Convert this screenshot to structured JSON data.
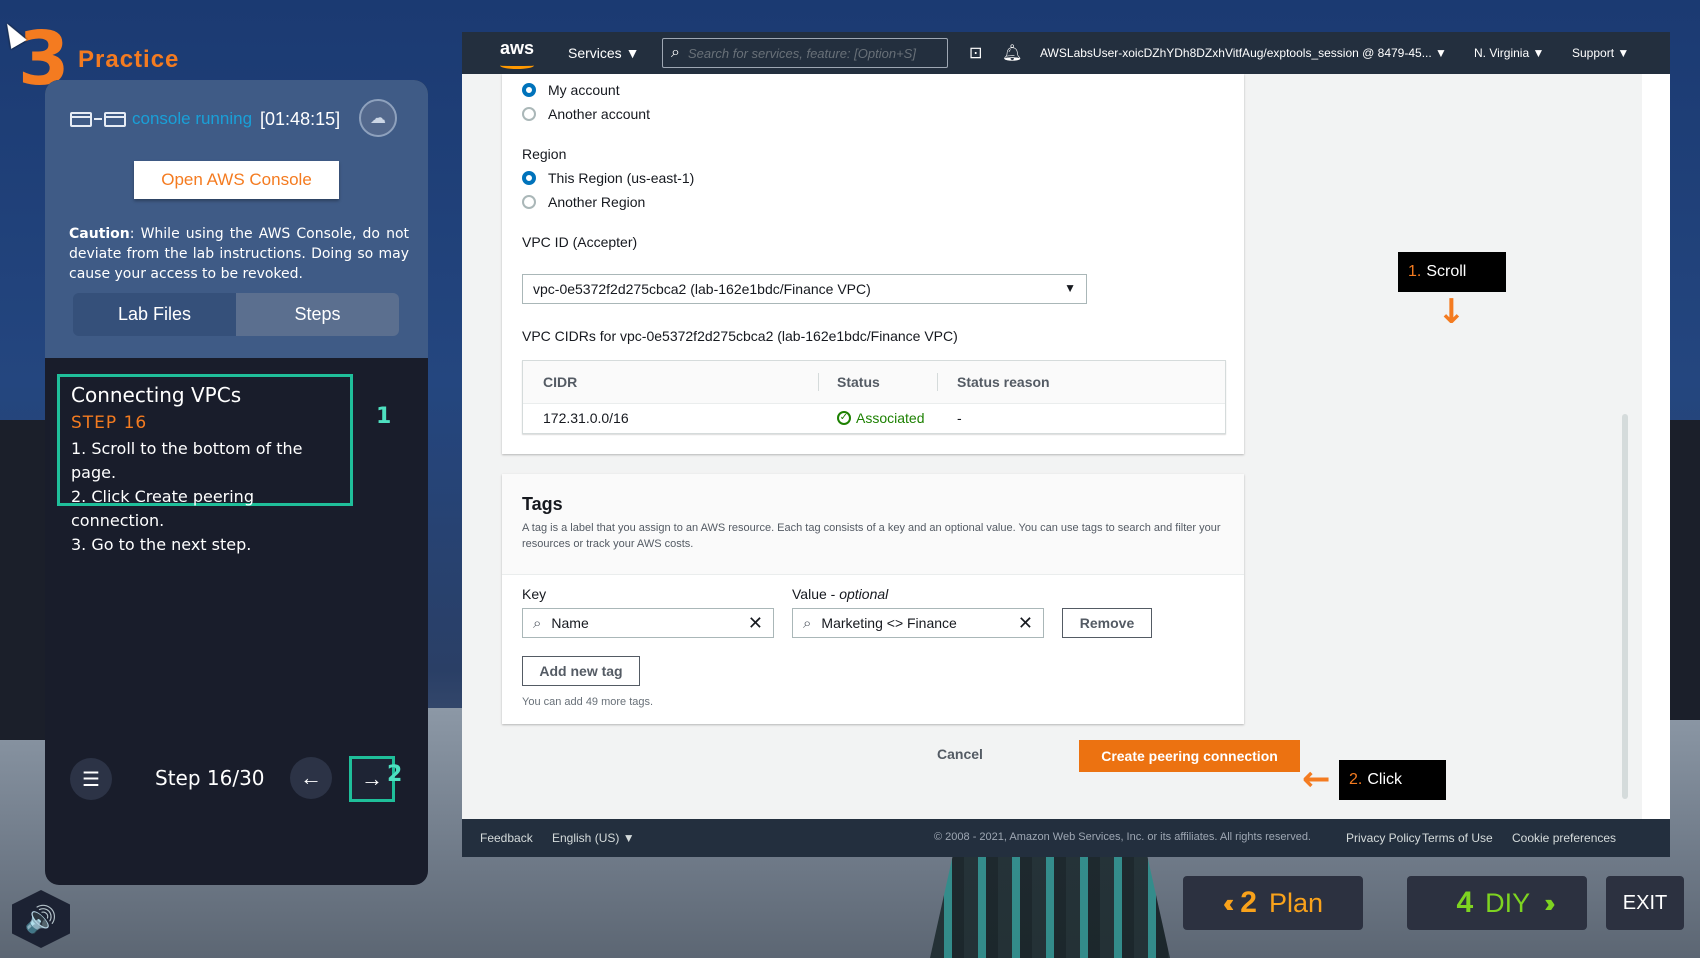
{
  "header": {
    "number": "3",
    "title": "Practice"
  },
  "console": {
    "status": "console running",
    "timer": "[01:48:15]",
    "open_button": "Open AWS Console"
  },
  "caution": {
    "label": "Caution",
    "text": ": While using the AWS Console, do not deviate from the lab instructions. Doing so may cause your access to be revoked."
  },
  "tabs": {
    "lab_files": "Lab Files",
    "steps": "Steps"
  },
  "step": {
    "title": "Connecting VPCs",
    "number": "STEP 16",
    "lines": [
      "1. Scroll to the bottom of the page.",
      "2. Click Create peering connection.",
      "3. Go to the next step."
    ]
  },
  "markers": {
    "one": "1",
    "two": "2"
  },
  "nav": {
    "step_count": "Step 16/30",
    "prev_icon": "arrow-left-icon",
    "next_icon": "arrow-right-icon"
  },
  "aws_nav": {
    "logo": "aws",
    "services": "Services ▼",
    "search_placeholder": "Search for services, feature: [Option+S]",
    "user": "AWSLabsUser-xoicDZhYDh8DZxhVitfAug/exptools_session @ 8479-45... ▼",
    "region": "N. Virginia ▼",
    "support": "Support ▼"
  },
  "form": {
    "my_account": "My account",
    "another_account": "Another account",
    "region_label": "Region",
    "this_region": "This Region (us-east-1)",
    "another_region": "Another Region",
    "vpc_id_label": "VPC ID (Accepter)",
    "vpc_id_value": "vpc-0e5372f2d275cbca2 (lab-162e1bdc/Finance VPC)",
    "cidrs_label": "VPC CIDRs for vpc-0e5372f2d275cbca2 (lab-162e1bdc/Finance VPC)",
    "table": {
      "headers": [
        "CIDR",
        "Status",
        "Status reason"
      ],
      "row": [
        "172.31.0.0/16",
        "Associated",
        "-"
      ]
    }
  },
  "tags": {
    "title": "Tags",
    "description": "A tag is a label that you assign to an AWS resource. Each tag consists of a key and an optional value. You can use tags to search and filter your resources or track your AWS costs.",
    "key_label": "Key",
    "value_label": "Value - ",
    "value_optional": "optional",
    "key_value": "Name",
    "value_value": "Marketing <> Finance",
    "remove": "Remove",
    "add_new": "Add new tag",
    "hint": "You can add 49 more tags."
  },
  "actions": {
    "cancel": "Cancel",
    "create": "Create peering connection"
  },
  "footer": {
    "feedback": "Feedback",
    "language": "English (US) ▼",
    "copyright": "© 2008 - 2021, Amazon Web Services, Inc. or its affiliates. All rights reserved.",
    "privacy": "Privacy Policy",
    "terms": "Terms of Use",
    "cookies": "Cookie preferences"
  },
  "callouts": {
    "scroll_num": "1.",
    "scroll": "Scroll",
    "click_num": "2.",
    "click": "Click"
  },
  "bottom": {
    "plan_num": "2",
    "plan": "Plan",
    "diy_num": "4",
    "diy": "DIY",
    "exit": "EXIT"
  },
  "colors": {
    "accent": "#f47b20",
    "teal": "#1fbf9a",
    "aws_orange": "#ec7211",
    "aws_nav": "#232f3e"
  }
}
